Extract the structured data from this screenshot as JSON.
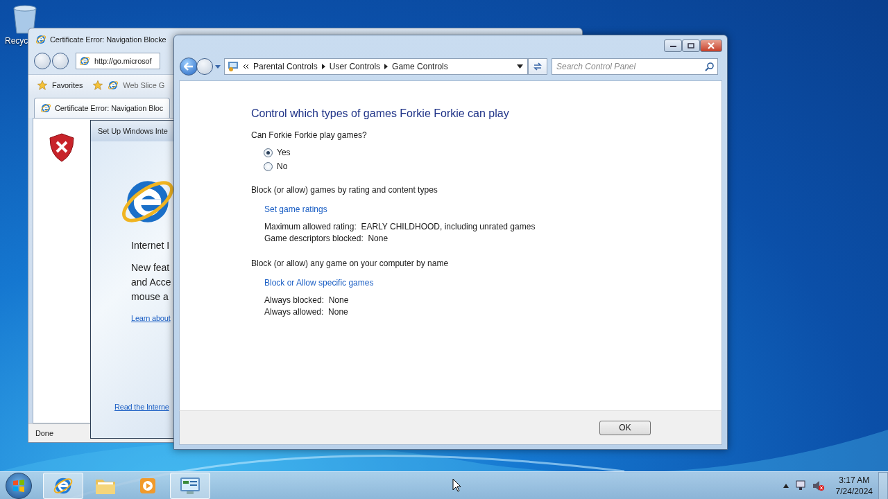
{
  "desktop": {
    "icons": [
      {
        "label": "Recyc"
      }
    ]
  },
  "browser_window": {
    "title": "Certificate Error: Navigation Blocke",
    "address": "http://go.microsof",
    "favorites_bar": [
      "Favorites",
      "Web Slice G"
    ],
    "tab": "Certificate Error: Navigation Bloc",
    "status": "Done",
    "dialog": {
      "title": "Set Up Windows Inte",
      "heading": "Internet I",
      "lines": [
        "New feat",
        "and Acce",
        "mouse a"
      ],
      "links": [
        "Learn about",
        "Read the Interne"
      ]
    }
  },
  "control_panel": {
    "breadcrumb": [
      "Parental Controls",
      "User Controls",
      "Game Controls"
    ],
    "search": {
      "placeholder": "Search Control Panel"
    },
    "heading": "Control which types of games Forkie Forkie can play",
    "question": "Can Forkie Forkie play games?",
    "options": [
      {
        "label": "Yes",
        "selected": true
      },
      {
        "label": "No",
        "selected": false
      }
    ],
    "sections": [
      {
        "title": "Block (or allow) games by rating and content types",
        "link": "Set game ratings",
        "details": [
          "Maximum allowed rating:  EARLY CHILDHOOD, including unrated games",
          "Game descriptors blocked:  None"
        ]
      },
      {
        "title": "Block (or allow) any game on your computer by name",
        "link": "Block or Allow specific games",
        "details": [
          "Always blocked:  None",
          "Always allowed:  None"
        ]
      }
    ],
    "ok_button": "OK"
  },
  "taskbar": {
    "items": [
      {
        "kind": "browser",
        "active": true
      },
      {
        "kind": "folder",
        "active": false
      },
      {
        "kind": "media",
        "active": false
      },
      {
        "kind": "control-panel",
        "active": true
      }
    ],
    "clock": {
      "time": "3:17 AM",
      "date": "7/24/2024"
    }
  }
}
